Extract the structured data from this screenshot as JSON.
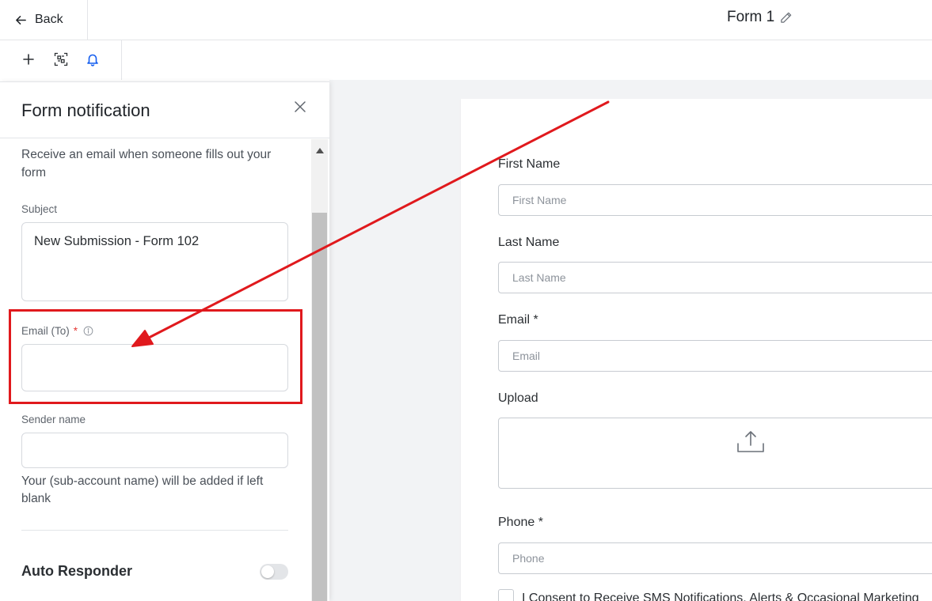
{
  "header": {
    "back_label": "Back",
    "form_title": "Form 1"
  },
  "toolbar": {
    "icons": [
      "add-icon",
      "qr-scan-icon",
      "bell-icon"
    ]
  },
  "panel": {
    "title": "Form notification",
    "description": "Receive an email when someone fills out your form",
    "subject_label": "Subject",
    "subject_value": "New Submission - Form 102",
    "email_label": "Email (To)",
    "email_required": "*",
    "email_value": "",
    "sender_label": "Sender name",
    "sender_value": "",
    "sender_help": "Your (sub-account name) will be added if left blank",
    "auto_responder_label": "Auto Responder",
    "auto_responder_on": false
  },
  "form": {
    "fields": [
      {
        "label": "First Name",
        "placeholder": "First Name"
      },
      {
        "label": "Last Name",
        "placeholder": "Last Name"
      },
      {
        "label": "Email *",
        "placeholder": "Email"
      },
      {
        "label": "Upload"
      },
      {
        "label": "Phone *",
        "placeholder": "Phone"
      }
    ],
    "consent_text": "I Consent to Receive SMS Notifications, Alerts & Occasional Marketing"
  },
  "colors": {
    "annotation_red": "#e0191d",
    "accent_blue": "#155eef",
    "required_red": "#e53935"
  }
}
